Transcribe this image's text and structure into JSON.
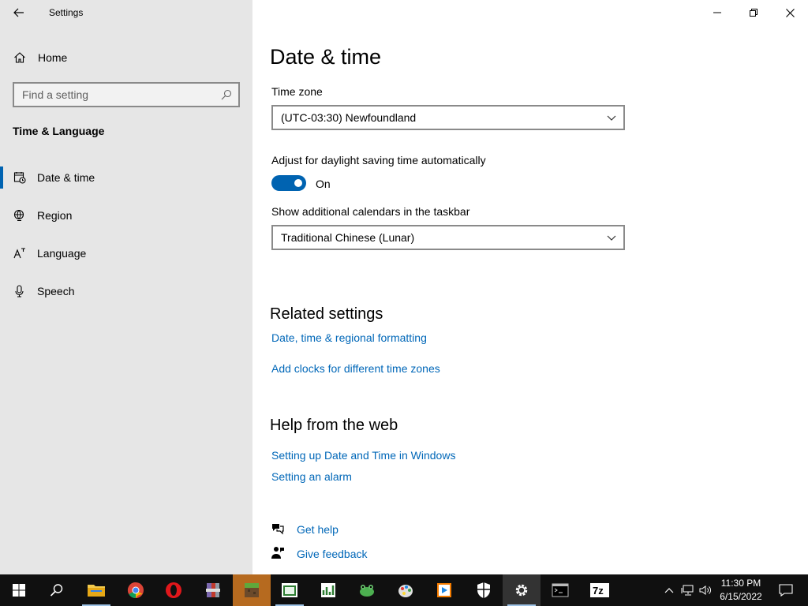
{
  "window": {
    "title": "Settings"
  },
  "sidebar": {
    "home_label": "Home",
    "search_placeholder": "Find a setting",
    "section_title": "Time & Language",
    "items": [
      {
        "label": "Date & time",
        "icon": "date-time-icon",
        "selected": true
      },
      {
        "label": "Region",
        "icon": "globe-icon",
        "selected": false
      },
      {
        "label": "Language",
        "icon": "language-icon",
        "selected": false
      },
      {
        "label": "Speech",
        "icon": "microphone-icon",
        "selected": false
      }
    ]
  },
  "main": {
    "title": "Date & time",
    "time_zone": {
      "label": "Time zone",
      "value": "(UTC-03:30) Newfoundland"
    },
    "daylight": {
      "label": "Adjust for daylight saving time automatically",
      "state": "On",
      "enabled": true
    },
    "calendars": {
      "label": "Show additional calendars in the taskbar",
      "value": "Traditional Chinese (Lunar)"
    },
    "related": {
      "title": "Related settings",
      "links": [
        "Date, time & regional formatting",
        "Add clocks for different time zones"
      ]
    },
    "help_web": {
      "title": "Help from the web",
      "links": [
        "Setting up Date and Time in Windows",
        "Setting an alarm"
      ]
    },
    "get_help": "Get help",
    "give_feedback": "Give feedback"
  },
  "taskbar": {
    "apps": [
      "start-icon",
      "search-icon",
      "file-explorer-icon",
      "chrome-icon",
      "opera-icon",
      "archive-tool-icon",
      "minecraft-icon",
      "app-window-icon",
      "spreadsheet-app-icon",
      "frog-app-icon",
      "paint-icon",
      "media-player-icon",
      "security-shield-icon",
      "settings-gear-icon",
      "terminal-icon",
      "7zip-icon"
    ],
    "clock_time": "11:30 PM",
    "clock_date": "6/15/2022",
    "colors": {
      "background": "#101010",
      "accent": "#0063b1",
      "link": "#0067b8"
    }
  }
}
